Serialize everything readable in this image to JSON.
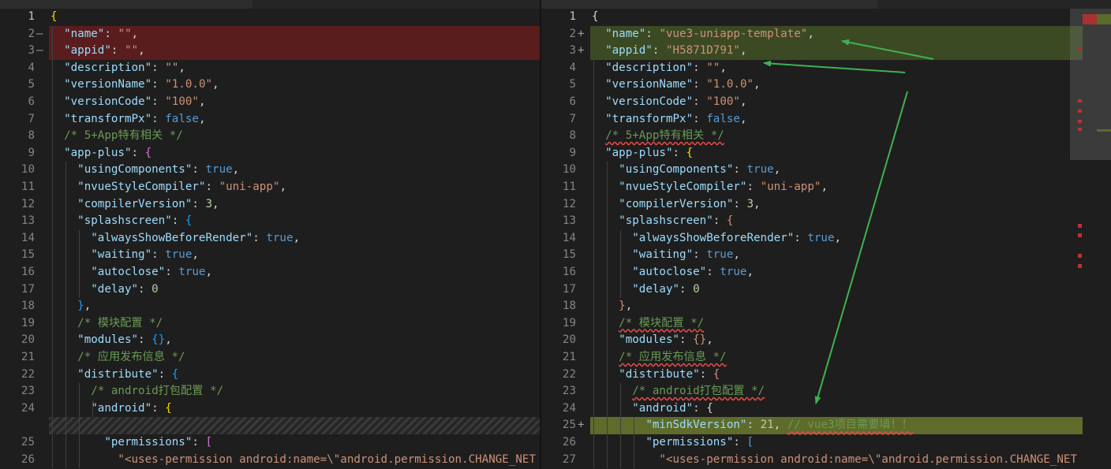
{
  "left_pane": {
    "lines": [
      {
        "num": "1",
        "marker": "",
        "tokens": [
          [
            "{",
            "br1"
          ]
        ]
      },
      {
        "num": "2",
        "marker": "—",
        "diff": "del",
        "tokens": [
          [
            "  ",
            ""
          ],
          [
            "\"name\"",
            "k"
          ],
          [
            ": ",
            "p"
          ],
          [
            "\"\"",
            "s"
          ],
          [
            ",",
            "p"
          ]
        ]
      },
      {
        "num": "3",
        "marker": "—",
        "diff": "del",
        "tokens": [
          [
            "  ",
            ""
          ],
          [
            "\"appid\"",
            "k"
          ],
          [
            ": ",
            "p"
          ],
          [
            "\"\"",
            "s"
          ],
          [
            ",",
            "p"
          ]
        ]
      },
      {
        "num": "4",
        "marker": "",
        "tokens": [
          [
            "  ",
            ""
          ],
          [
            "\"description\"",
            "k"
          ],
          [
            ": ",
            "p"
          ],
          [
            "\"\"",
            "s"
          ],
          [
            ",",
            "p"
          ]
        ]
      },
      {
        "num": "5",
        "marker": "",
        "tokens": [
          [
            "  ",
            ""
          ],
          [
            "\"versionName\"",
            "k"
          ],
          [
            ": ",
            "p"
          ],
          [
            "\"1.0.0\"",
            "s"
          ],
          [
            ",",
            "p"
          ]
        ]
      },
      {
        "num": "6",
        "marker": "",
        "tokens": [
          [
            "  ",
            ""
          ],
          [
            "\"versionCode\"",
            "k"
          ],
          [
            ": ",
            "p"
          ],
          [
            "\"100\"",
            "s"
          ],
          [
            ",",
            "p"
          ]
        ]
      },
      {
        "num": "7",
        "marker": "",
        "tokens": [
          [
            "  ",
            ""
          ],
          [
            "\"transformPx\"",
            "k"
          ],
          [
            ": ",
            "p"
          ],
          [
            "false",
            "b"
          ],
          [
            ",",
            "p"
          ]
        ]
      },
      {
        "num": "8",
        "marker": "",
        "tokens": [
          [
            "  ",
            ""
          ],
          [
            "/* 5+App特有相关 */",
            "c"
          ]
        ]
      },
      {
        "num": "9",
        "marker": "",
        "tokens": [
          [
            "  ",
            ""
          ],
          [
            "\"app-plus\"",
            "k"
          ],
          [
            ": ",
            "p"
          ],
          [
            "{",
            "br2"
          ]
        ]
      },
      {
        "num": "10",
        "marker": "",
        "tokens": [
          [
            "    ",
            ""
          ],
          [
            "\"usingComponents\"",
            "k"
          ],
          [
            ": ",
            "p"
          ],
          [
            "true",
            "b"
          ],
          [
            ",",
            "p"
          ]
        ]
      },
      {
        "num": "11",
        "marker": "",
        "tokens": [
          [
            "    ",
            ""
          ],
          [
            "\"nvueStyleCompiler\"",
            "k"
          ],
          [
            ": ",
            "p"
          ],
          [
            "\"uni-app\"",
            "s"
          ],
          [
            ",",
            "p"
          ]
        ]
      },
      {
        "num": "12",
        "marker": "",
        "tokens": [
          [
            "    ",
            ""
          ],
          [
            "\"compilerVersion\"",
            "k"
          ],
          [
            ": ",
            "p"
          ],
          [
            "3",
            "nm"
          ],
          [
            ",",
            "p"
          ]
        ]
      },
      {
        "num": "13",
        "marker": "",
        "tokens": [
          [
            "    ",
            ""
          ],
          [
            "\"splashscreen\"",
            "k"
          ],
          [
            ": ",
            "p"
          ],
          [
            "{",
            "br3"
          ]
        ]
      },
      {
        "num": "14",
        "marker": "",
        "tokens": [
          [
            "      ",
            ""
          ],
          [
            "\"alwaysShowBeforeRender\"",
            "k"
          ],
          [
            ": ",
            "p"
          ],
          [
            "true",
            "b"
          ],
          [
            ",",
            "p"
          ]
        ]
      },
      {
        "num": "15",
        "marker": "",
        "tokens": [
          [
            "      ",
            ""
          ],
          [
            "\"waiting\"",
            "k"
          ],
          [
            ": ",
            "p"
          ],
          [
            "true",
            "b"
          ],
          [
            ",",
            "p"
          ]
        ]
      },
      {
        "num": "16",
        "marker": "",
        "tokens": [
          [
            "      ",
            ""
          ],
          [
            "\"autoclose\"",
            "k"
          ],
          [
            ": ",
            "p"
          ],
          [
            "true",
            "b"
          ],
          [
            ",",
            "p"
          ]
        ]
      },
      {
        "num": "17",
        "marker": "",
        "tokens": [
          [
            "      ",
            ""
          ],
          [
            "\"delay\"",
            "k"
          ],
          [
            ": ",
            "p"
          ],
          [
            "0",
            "nm"
          ]
        ]
      },
      {
        "num": "18",
        "marker": "",
        "tokens": [
          [
            "    ",
            ""
          ],
          [
            "}",
            "br3"
          ],
          [
            ",",
            "p"
          ]
        ]
      },
      {
        "num": "19",
        "marker": "",
        "tokens": [
          [
            "    ",
            ""
          ],
          [
            "/* 模块配置 */",
            "c"
          ]
        ]
      },
      {
        "num": "20",
        "marker": "",
        "tokens": [
          [
            "    ",
            ""
          ],
          [
            "\"modules\"",
            "k"
          ],
          [
            ": ",
            "p"
          ],
          [
            "{}",
            "br3"
          ],
          [
            ",",
            "p"
          ]
        ]
      },
      {
        "num": "21",
        "marker": "",
        "tokens": [
          [
            "    ",
            ""
          ],
          [
            "/* 应用发布信息 */",
            "c"
          ]
        ]
      },
      {
        "num": "22",
        "marker": "",
        "tokens": [
          [
            "    ",
            ""
          ],
          [
            "\"distribute\"",
            "k"
          ],
          [
            ": ",
            "p"
          ],
          [
            "{",
            "br3"
          ]
        ]
      },
      {
        "num": "23",
        "marker": "",
        "tokens": [
          [
            "      ",
            ""
          ],
          [
            "/* android打包配置 */",
            "c"
          ]
        ]
      },
      {
        "num": "24",
        "marker": "",
        "tokens": [
          [
            "      ",
            ""
          ],
          [
            "\"android\"",
            "k"
          ],
          [
            ": ",
            "p"
          ],
          [
            "{",
            "br1"
          ]
        ]
      },
      {
        "num": "",
        "marker": "",
        "diff": "hatch",
        "tokens": []
      },
      {
        "num": "25",
        "marker": "",
        "tokens": [
          [
            "        ",
            ""
          ],
          [
            "\"permissions\"",
            "k"
          ],
          [
            ": ",
            "p"
          ],
          [
            "[",
            "br2"
          ]
        ]
      },
      {
        "num": "26",
        "marker": "",
        "tokens": [
          [
            "          ",
            ""
          ],
          [
            "\"<uses-permission android:name=\\\"android.permission.CHANGE_NET",
            "s"
          ]
        ]
      }
    ]
  },
  "right_pane": {
    "lines": [
      {
        "num": "1",
        "marker": "",
        "tokens": [
          [
            "{",
            "p"
          ]
        ]
      },
      {
        "num": "2",
        "marker": "+",
        "diff": "add",
        "tokens": [
          [
            "  ",
            ""
          ],
          [
            "\"name\"",
            "k"
          ],
          [
            ": ",
            "p"
          ],
          [
            "\"vue3-uniapp-template\"",
            "s"
          ],
          [
            ",",
            "p"
          ]
        ]
      },
      {
        "num": "3",
        "marker": "+",
        "diff": "add",
        "tokens": [
          [
            "  ",
            ""
          ],
          [
            "\"appid\"",
            "k"
          ],
          [
            ": ",
            "p"
          ],
          [
            "\"H5871D791\"",
            "s"
          ],
          [
            ",",
            "p"
          ]
        ]
      },
      {
        "num": "4",
        "marker": "",
        "tokens": [
          [
            "  ",
            ""
          ],
          [
            "\"description\"",
            "k"
          ],
          [
            ": ",
            "p"
          ],
          [
            "\"\"",
            "s"
          ],
          [
            ",",
            "p"
          ]
        ]
      },
      {
        "num": "5",
        "marker": "",
        "tokens": [
          [
            "  ",
            ""
          ],
          [
            "\"versionName\"",
            "k"
          ],
          [
            ": ",
            "p"
          ],
          [
            "\"1.0.0\"",
            "s"
          ],
          [
            ",",
            "p"
          ]
        ]
      },
      {
        "num": "6",
        "marker": "",
        "tokens": [
          [
            "  ",
            ""
          ],
          [
            "\"versionCode\"",
            "k"
          ],
          [
            ": ",
            "p"
          ],
          [
            "\"100\"",
            "s"
          ],
          [
            ",",
            "p"
          ]
        ]
      },
      {
        "num": "7",
        "marker": "",
        "tokens": [
          [
            "  ",
            ""
          ],
          [
            "\"transformPx\"",
            "k"
          ],
          [
            ": ",
            "p"
          ],
          [
            "false",
            "b"
          ],
          [
            ",",
            "p"
          ]
        ]
      },
      {
        "num": "8",
        "marker": "",
        "tokens": [
          [
            "  ",
            ""
          ],
          [
            "/* 5+App特有相关 */",
            "c wavy"
          ]
        ]
      },
      {
        "num": "9",
        "marker": "",
        "tokens": [
          [
            "  ",
            ""
          ],
          [
            "\"app-plus\"",
            "k"
          ],
          [
            ": ",
            "p"
          ],
          [
            "{",
            "br1"
          ]
        ]
      },
      {
        "num": "10",
        "marker": "",
        "tokens": [
          [
            "    ",
            ""
          ],
          [
            "\"usingComponents\"",
            "k"
          ],
          [
            ": ",
            "p"
          ],
          [
            "true",
            "b"
          ],
          [
            ",",
            "p"
          ]
        ]
      },
      {
        "num": "11",
        "marker": "",
        "tokens": [
          [
            "    ",
            ""
          ],
          [
            "\"nvueStyleCompiler\"",
            "k"
          ],
          [
            ": ",
            "p"
          ],
          [
            "\"uni-app\"",
            "s"
          ],
          [
            ",",
            "p"
          ]
        ]
      },
      {
        "num": "12",
        "marker": "",
        "tokens": [
          [
            "    ",
            ""
          ],
          [
            "\"compilerVersion\"",
            "k"
          ],
          [
            ": ",
            "p"
          ],
          [
            "3",
            "nm"
          ],
          [
            ",",
            "p"
          ]
        ]
      },
      {
        "num": "13",
        "marker": "",
        "tokens": [
          [
            "    ",
            ""
          ],
          [
            "\"splashscreen\"",
            "k"
          ],
          [
            ": ",
            "p"
          ],
          [
            "{",
            "s"
          ]
        ]
      },
      {
        "num": "14",
        "marker": "",
        "tokens": [
          [
            "      ",
            ""
          ],
          [
            "\"alwaysShowBeforeRender\"",
            "k"
          ],
          [
            ": ",
            "p"
          ],
          [
            "true",
            "b"
          ],
          [
            ",",
            "p"
          ]
        ]
      },
      {
        "num": "15",
        "marker": "",
        "tokens": [
          [
            "      ",
            ""
          ],
          [
            "\"waiting\"",
            "k"
          ],
          [
            ": ",
            "p"
          ],
          [
            "true",
            "b"
          ],
          [
            ",",
            "p"
          ]
        ]
      },
      {
        "num": "16",
        "marker": "",
        "tokens": [
          [
            "      ",
            ""
          ],
          [
            "\"autoclose\"",
            "k"
          ],
          [
            ": ",
            "p"
          ],
          [
            "true",
            "b"
          ],
          [
            ",",
            "p"
          ]
        ]
      },
      {
        "num": "17",
        "marker": "",
        "tokens": [
          [
            "      ",
            ""
          ],
          [
            "\"delay\"",
            "k"
          ],
          [
            ": ",
            "p"
          ],
          [
            "0",
            "nm"
          ]
        ]
      },
      {
        "num": "18",
        "marker": "",
        "tokens": [
          [
            "    ",
            ""
          ],
          [
            "}",
            "s"
          ],
          [
            ",",
            "p"
          ]
        ]
      },
      {
        "num": "19",
        "marker": "",
        "tokens": [
          [
            "    ",
            ""
          ],
          [
            "/* 模块配置 */",
            "c wavy"
          ]
        ]
      },
      {
        "num": "20",
        "marker": "",
        "tokens": [
          [
            "    ",
            ""
          ],
          [
            "\"modules\"",
            "k"
          ],
          [
            ": ",
            "p"
          ],
          [
            "{}",
            "s"
          ],
          [
            ",",
            "p"
          ]
        ]
      },
      {
        "num": "21",
        "marker": "",
        "tokens": [
          [
            "    ",
            ""
          ],
          [
            "/* 应用发布信息 */",
            "c wavy"
          ]
        ]
      },
      {
        "num": "22",
        "marker": "",
        "tokens": [
          [
            "    ",
            ""
          ],
          [
            "\"distribute\"",
            "k"
          ],
          [
            ": ",
            "p"
          ],
          [
            "{",
            "s"
          ]
        ]
      },
      {
        "num": "23",
        "marker": "",
        "tokens": [
          [
            "      ",
            ""
          ],
          [
            "/* android打包配置 */",
            "c wavy"
          ]
        ]
      },
      {
        "num": "24",
        "marker": "",
        "tokens": [
          [
            "      ",
            ""
          ],
          [
            "\"android\"",
            "k"
          ],
          [
            ": ",
            "p"
          ],
          [
            "{",
            "p"
          ]
        ]
      },
      {
        "num": "25",
        "marker": "+",
        "diff": "add-strong",
        "tokens": [
          [
            "        ",
            ""
          ],
          [
            "\"minSdkVersion\"",
            "k"
          ],
          [
            ": ",
            "p"
          ],
          [
            "21",
            "nm"
          ],
          [
            ", ",
            "p"
          ],
          [
            "// vue3项目需要填！！",
            "c wavy"
          ]
        ]
      },
      {
        "num": "26",
        "marker": "",
        "tokens": [
          [
            "        ",
            ""
          ],
          [
            "\"permissions\"",
            "k"
          ],
          [
            ": ",
            "p"
          ],
          [
            "[",
            "b"
          ]
        ]
      },
      {
        "num": "27",
        "marker": "",
        "tokens": [
          [
            "          ",
            ""
          ],
          [
            "\"<uses-permission android:name=\\\"android.permission.CHANGE_NET",
            "s"
          ]
        ]
      }
    ]
  },
  "colors": {
    "editor_bg": "#1e1e1e",
    "deleted_line": "#5a1d1d",
    "inserted_line": "#3b4a23",
    "inserted_line_strong": "#5f6b2a",
    "annotation_arrow": "#3fb24f"
  }
}
